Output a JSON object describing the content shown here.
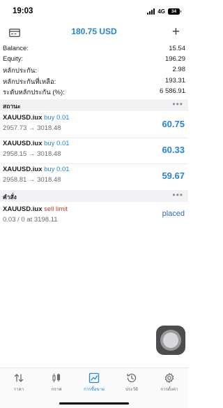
{
  "status_bar": {
    "time": "19:03",
    "network": "4G",
    "battery": "34"
  },
  "header": {
    "title": "180.75 USD"
  },
  "summary": [
    {
      "label": "Balance:",
      "value": "15.54"
    },
    {
      "label": "Equity:",
      "value": "196.29"
    },
    {
      "label": "หลักประกัน:",
      "value": "2.98"
    },
    {
      "label": "หลักประกันที่เหลือ:",
      "value": "193.31"
    },
    {
      "label": "ระดับหลักประกัน (%):",
      "value": "6 586.91"
    }
  ],
  "positions_section": {
    "title": "สถานะ",
    "more": "•••"
  },
  "positions": [
    {
      "symbol": "XAUUSD.iux",
      "side": "buy 0.01",
      "open_price": "2957.73",
      "arrow": "→",
      "current_price": "3018.48",
      "profit": "60.75"
    },
    {
      "symbol": "XAUUSD.iux",
      "side": "buy 0.01",
      "open_price": "2958.15",
      "arrow": "→",
      "current_price": "3018.48",
      "profit": "60.33"
    },
    {
      "symbol": "XAUUSD.iux",
      "side": "buy 0.01",
      "open_price": "2958.81",
      "arrow": "→",
      "current_price": "3018.48",
      "profit": "59.67"
    }
  ],
  "orders_section": {
    "title": "คำสั่ง",
    "more": "•••"
  },
  "orders": [
    {
      "symbol": "XAUUSD.iux",
      "side": "sell limit",
      "detail": "0.03 / 0 at 3198.11",
      "state": "placed"
    }
  ],
  "tabs": [
    {
      "label": "ราคา",
      "icon": "arrows-updown-icon",
      "active": false
    },
    {
      "label": "กราฟ",
      "icon": "candlestick-icon",
      "active": false
    },
    {
      "label": "การซื้อขาย",
      "icon": "trade-chart-icon",
      "active": true
    },
    {
      "label": "ประวัติ",
      "icon": "history-clock-icon",
      "active": false
    },
    {
      "label": "การตั้งค่า",
      "icon": "gear-icon",
      "active": false
    }
  ],
  "colors": {
    "accent": "#2a82d4",
    "sell": "#c0392b",
    "section_bg": "#f2f2f4"
  }
}
